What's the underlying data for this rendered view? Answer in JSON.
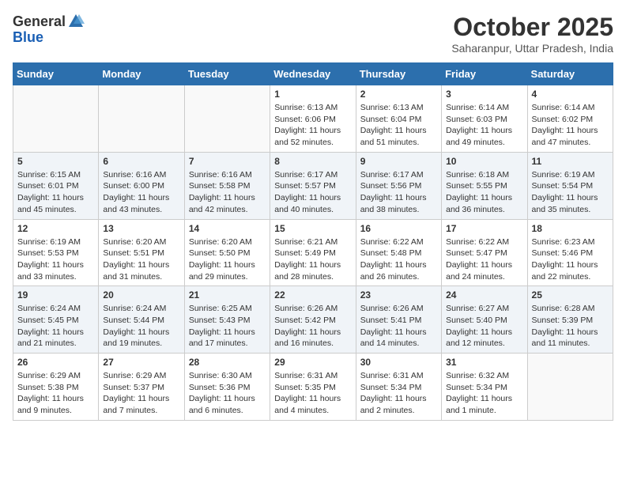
{
  "header": {
    "logo_general": "General",
    "logo_blue": "Blue",
    "month_title": "October 2025",
    "subtitle": "Saharanpur, Uttar Pradesh, India"
  },
  "weekdays": [
    "Sunday",
    "Monday",
    "Tuesday",
    "Wednesday",
    "Thursday",
    "Friday",
    "Saturday"
  ],
  "weeks": [
    [
      {
        "day": "",
        "info": ""
      },
      {
        "day": "",
        "info": ""
      },
      {
        "day": "",
        "info": ""
      },
      {
        "day": "1",
        "info": "Sunrise: 6:13 AM\nSunset: 6:06 PM\nDaylight: 11 hours and 52 minutes."
      },
      {
        "day": "2",
        "info": "Sunrise: 6:13 AM\nSunset: 6:04 PM\nDaylight: 11 hours and 51 minutes."
      },
      {
        "day": "3",
        "info": "Sunrise: 6:14 AM\nSunset: 6:03 PM\nDaylight: 11 hours and 49 minutes."
      },
      {
        "day": "4",
        "info": "Sunrise: 6:14 AM\nSunset: 6:02 PM\nDaylight: 11 hours and 47 minutes."
      }
    ],
    [
      {
        "day": "5",
        "info": "Sunrise: 6:15 AM\nSunset: 6:01 PM\nDaylight: 11 hours and 45 minutes."
      },
      {
        "day": "6",
        "info": "Sunrise: 6:16 AM\nSunset: 6:00 PM\nDaylight: 11 hours and 43 minutes."
      },
      {
        "day": "7",
        "info": "Sunrise: 6:16 AM\nSunset: 5:58 PM\nDaylight: 11 hours and 42 minutes."
      },
      {
        "day": "8",
        "info": "Sunrise: 6:17 AM\nSunset: 5:57 PM\nDaylight: 11 hours and 40 minutes."
      },
      {
        "day": "9",
        "info": "Sunrise: 6:17 AM\nSunset: 5:56 PM\nDaylight: 11 hours and 38 minutes."
      },
      {
        "day": "10",
        "info": "Sunrise: 6:18 AM\nSunset: 5:55 PM\nDaylight: 11 hours and 36 minutes."
      },
      {
        "day": "11",
        "info": "Sunrise: 6:19 AM\nSunset: 5:54 PM\nDaylight: 11 hours and 35 minutes."
      }
    ],
    [
      {
        "day": "12",
        "info": "Sunrise: 6:19 AM\nSunset: 5:53 PM\nDaylight: 11 hours and 33 minutes."
      },
      {
        "day": "13",
        "info": "Sunrise: 6:20 AM\nSunset: 5:51 PM\nDaylight: 11 hours and 31 minutes."
      },
      {
        "day": "14",
        "info": "Sunrise: 6:20 AM\nSunset: 5:50 PM\nDaylight: 11 hours and 29 minutes."
      },
      {
        "day": "15",
        "info": "Sunrise: 6:21 AM\nSunset: 5:49 PM\nDaylight: 11 hours and 28 minutes."
      },
      {
        "day": "16",
        "info": "Sunrise: 6:22 AM\nSunset: 5:48 PM\nDaylight: 11 hours and 26 minutes."
      },
      {
        "day": "17",
        "info": "Sunrise: 6:22 AM\nSunset: 5:47 PM\nDaylight: 11 hours and 24 minutes."
      },
      {
        "day": "18",
        "info": "Sunrise: 6:23 AM\nSunset: 5:46 PM\nDaylight: 11 hours and 22 minutes."
      }
    ],
    [
      {
        "day": "19",
        "info": "Sunrise: 6:24 AM\nSunset: 5:45 PM\nDaylight: 11 hours and 21 minutes."
      },
      {
        "day": "20",
        "info": "Sunrise: 6:24 AM\nSunset: 5:44 PM\nDaylight: 11 hours and 19 minutes."
      },
      {
        "day": "21",
        "info": "Sunrise: 6:25 AM\nSunset: 5:43 PM\nDaylight: 11 hours and 17 minutes."
      },
      {
        "day": "22",
        "info": "Sunrise: 6:26 AM\nSunset: 5:42 PM\nDaylight: 11 hours and 16 minutes."
      },
      {
        "day": "23",
        "info": "Sunrise: 6:26 AM\nSunset: 5:41 PM\nDaylight: 11 hours and 14 minutes."
      },
      {
        "day": "24",
        "info": "Sunrise: 6:27 AM\nSunset: 5:40 PM\nDaylight: 11 hours and 12 minutes."
      },
      {
        "day": "25",
        "info": "Sunrise: 6:28 AM\nSunset: 5:39 PM\nDaylight: 11 hours and 11 minutes."
      }
    ],
    [
      {
        "day": "26",
        "info": "Sunrise: 6:29 AM\nSunset: 5:38 PM\nDaylight: 11 hours and 9 minutes."
      },
      {
        "day": "27",
        "info": "Sunrise: 6:29 AM\nSunset: 5:37 PM\nDaylight: 11 hours and 7 minutes."
      },
      {
        "day": "28",
        "info": "Sunrise: 6:30 AM\nSunset: 5:36 PM\nDaylight: 11 hours and 6 minutes."
      },
      {
        "day": "29",
        "info": "Sunrise: 6:31 AM\nSunset: 5:35 PM\nDaylight: 11 hours and 4 minutes."
      },
      {
        "day": "30",
        "info": "Sunrise: 6:31 AM\nSunset: 5:34 PM\nDaylight: 11 hours and 2 minutes."
      },
      {
        "day": "31",
        "info": "Sunrise: 6:32 AM\nSunset: 5:34 PM\nDaylight: 11 hours and 1 minute."
      },
      {
        "day": "",
        "info": ""
      }
    ]
  ]
}
